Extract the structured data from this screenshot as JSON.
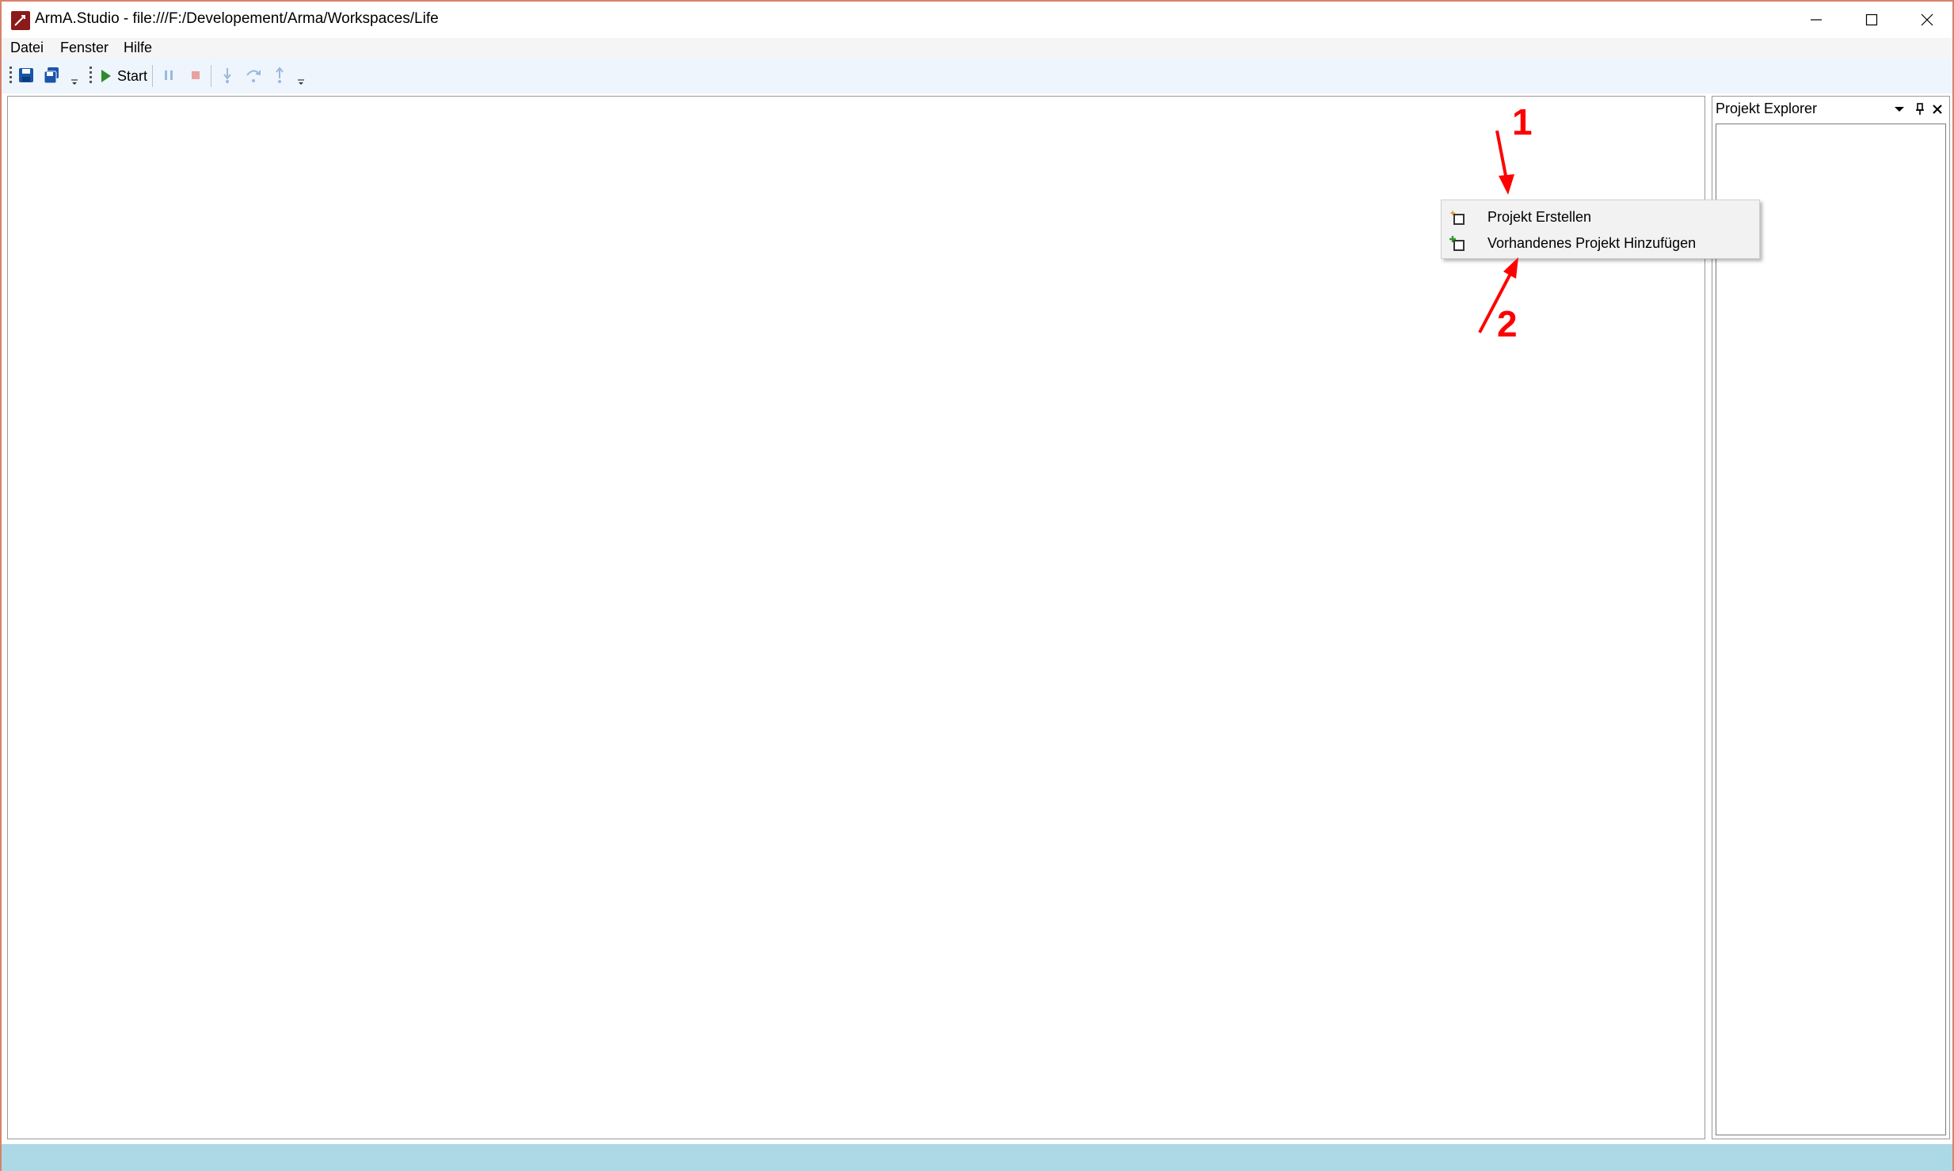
{
  "window": {
    "title": "ArmA.Studio - file:///F:/Developement/Arma/Workspaces/Life"
  },
  "menu": {
    "items": [
      "Datei",
      "Fenster",
      "Hilfe"
    ]
  },
  "toolbar": {
    "start_label": "Start",
    "icons": [
      "save-icon",
      "save-all-icon",
      "play-icon",
      "pause-icon",
      "stop-icon",
      "step-into-icon",
      "step-over-icon",
      "step-out-icon"
    ]
  },
  "explorer": {
    "title": "Projekt Explorer"
  },
  "context_menu": {
    "items": [
      {
        "label": "Projekt Erstellen",
        "icon": "new-project-icon"
      },
      {
        "label": "Vorhandenes Projekt Hinzufügen",
        "icon": "add-existing-project-icon"
      }
    ]
  },
  "annotations": {
    "markers": [
      "1",
      "2"
    ],
    "color": "#ff0000"
  },
  "colors": {
    "statusbar": "#add8e6",
    "toolbar": "#eef5fc",
    "window_border": "#d9826a",
    "start_green": "#2e8b2e"
  }
}
